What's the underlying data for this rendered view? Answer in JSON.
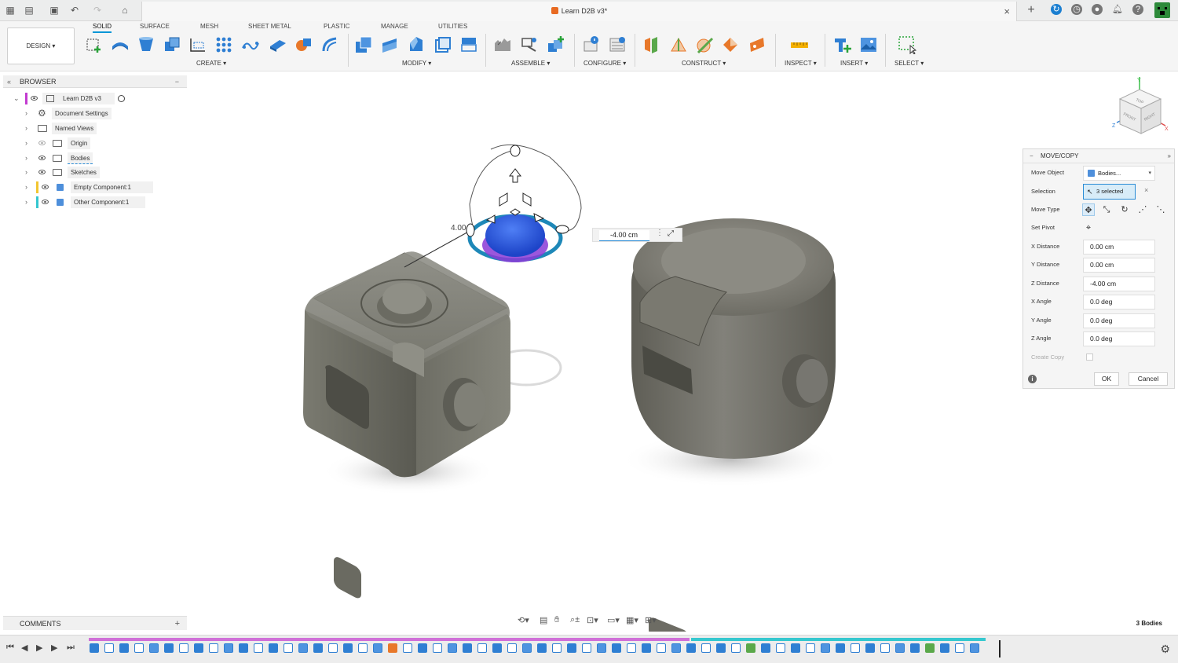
{
  "window": {
    "doc_title": "Learn D2B v3*"
  },
  "ribbon": {
    "workspace": "DESIGN",
    "tabs": [
      "SOLID",
      "SURFACE",
      "MESH",
      "SHEET METAL",
      "PLASTIC",
      "MANAGE",
      "UTILITIES"
    ],
    "active_tab": "SOLID",
    "groups": [
      "CREATE",
      "MODIFY",
      "ASSEMBLE",
      "CONFIGURE",
      "CONSTRUCT",
      "INSPECT",
      "INSERT",
      "SELECT"
    ]
  },
  "browser": {
    "title": "BROWSER",
    "root": "Learn D2B v3",
    "items": [
      "Document Settings",
      "Named Views",
      "Origin",
      "Bodies",
      "Sketches",
      "Empty Component:1",
      "Other Component:1"
    ]
  },
  "viewport": {
    "dimension_label": "4.00",
    "value_input": "-4.00 cm"
  },
  "viewcube": {
    "faces": [
      "TOP",
      "FRONT",
      "RIGHT"
    ],
    "axes": [
      "Y",
      "Z",
      "X"
    ]
  },
  "move_copy": {
    "title": "MOVE/COPY",
    "move_object_label": "Move Object",
    "move_object_value": "Bodies...",
    "selection_label": "Selection",
    "selection_value": "3 selected",
    "move_type_label": "Move Type",
    "set_pivot_label": "Set Pivot",
    "x_distance_label": "X Distance",
    "x_distance": "0.00 cm",
    "y_distance_label": "Y Distance",
    "y_distance": "0.00 cm",
    "z_distance_label": "Z Distance",
    "z_distance": "-4.00 cm",
    "x_angle_label": "X Angle",
    "x_angle": "0.0 deg",
    "y_angle_label": "Y Angle",
    "y_angle": "0.0 deg",
    "z_angle_label": "Z Angle",
    "z_angle": "0.0 deg",
    "create_copy_label": "Create Copy",
    "ok": "OK",
    "cancel": "Cancel"
  },
  "footer": {
    "comments": "COMMENTS",
    "bodies_count": "3 Bodies"
  }
}
